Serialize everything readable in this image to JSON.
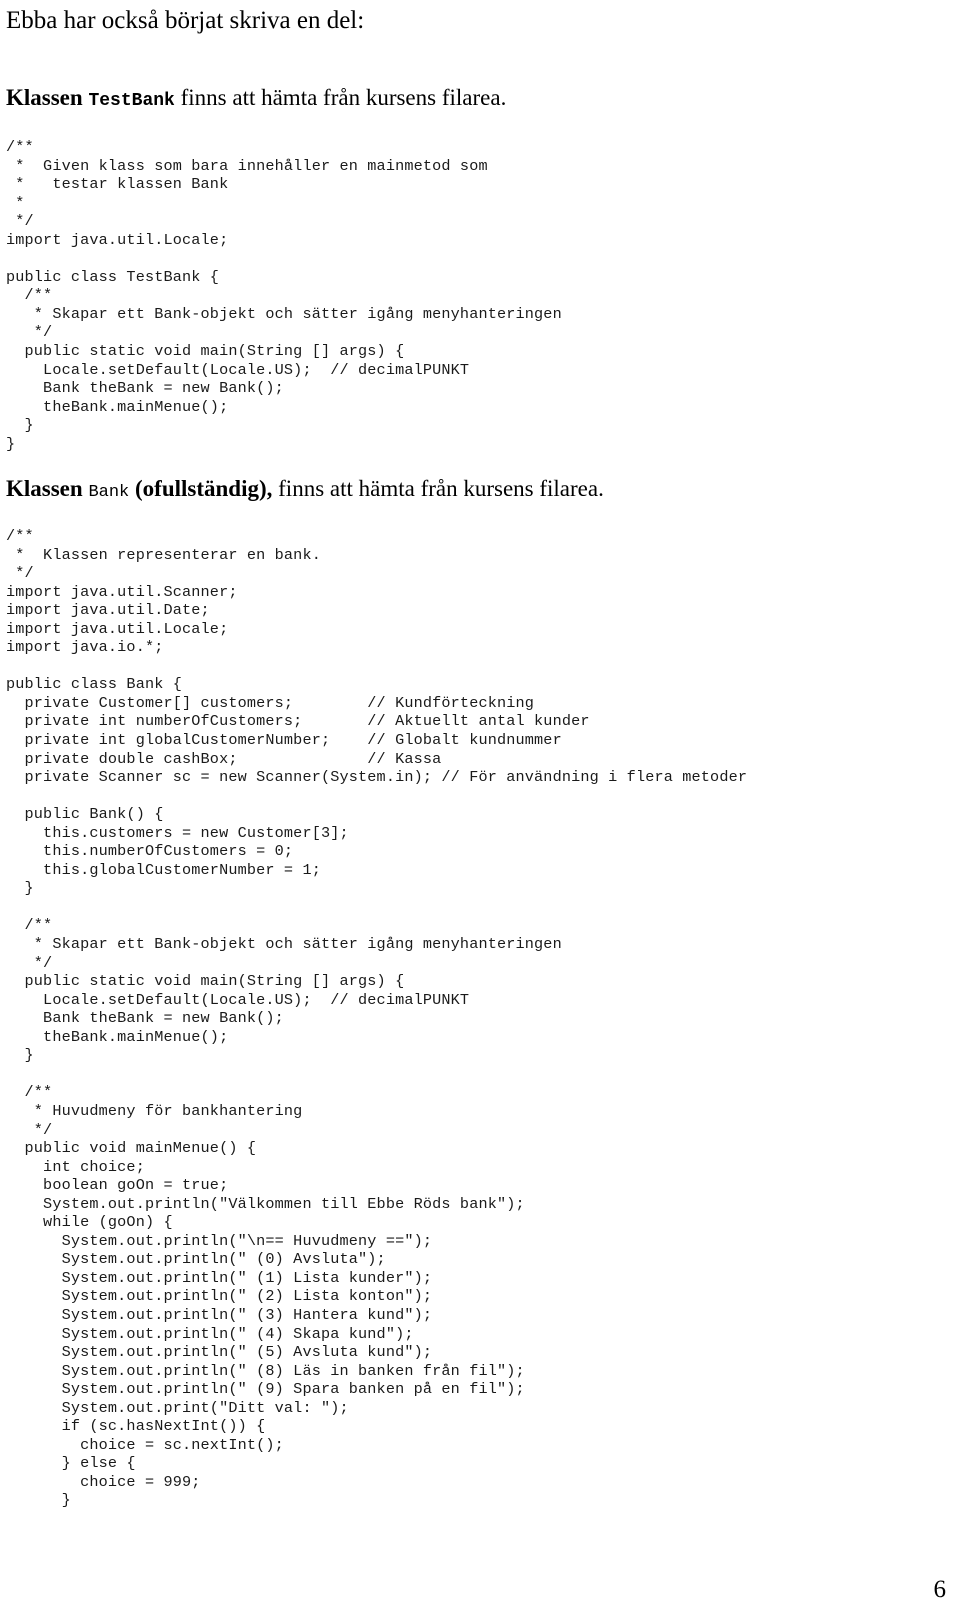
{
  "document": {
    "intro_line": "Ebba har också börjat skriva en del:",
    "page_number": "6"
  },
  "heading_testbank": {
    "prefix_bold": "Klassen",
    "class_name": "TestBank",
    "suffix": "finns att hämta från kursens filarea."
  },
  "heading_bank": {
    "prefix_bold": "Klassen",
    "class_name": "Bank",
    "qualifier_bold": "(ofullständig),",
    "suffix": "finns att hämta från kursens filarea."
  },
  "code_testbank": {
    "language": "java",
    "text": "/**\n *  Given klass som bara innehåller en mainmetod som\n *   testar klassen Bank\n *\n */\nimport java.util.Locale;\n\npublic class TestBank {\n  /**\n   * Skapar ett Bank-objekt och sätter igång menyhanteringen\n   */\n  public static void main(String [] args) {\n    Locale.setDefault(Locale.US);  // decimalPUNKT\n    Bank theBank = new Bank();\n    theBank.mainMenue();\n  }\n}"
  },
  "code_bank": {
    "language": "java",
    "text": "/**\n *  Klassen representerar en bank.\n */\nimport java.util.Scanner;\nimport java.util.Date;\nimport java.util.Locale;\nimport java.io.*;\n\npublic class Bank {\n  private Customer[] customers;        // Kundförteckning\n  private int numberOfCustomers;       // Aktuellt antal kunder\n  private int globalCustomerNumber;    // Globalt kundnummer\n  private double cashBox;              // Kassa\n  private Scanner sc = new Scanner(System.in); // För användning i flera metoder\n\n  public Bank() {\n    this.customers = new Customer[3];\n    this.numberOfCustomers = 0;\n    this.globalCustomerNumber = 1;\n  }\n\n  /**\n   * Skapar ett Bank-objekt och sätter igång menyhanteringen\n   */\n  public static void main(String [] args) {\n    Locale.setDefault(Locale.US);  // decimalPUNKT\n    Bank theBank = new Bank();\n    theBank.mainMenue();\n  }\n\n  /**\n   * Huvudmeny för bankhantering\n   */\n  public void mainMenue() {\n    int choice;\n    boolean goOn = true;\n    System.out.println(\"Välkommen till Ebbe Röds bank\");\n    while (goOn) {\n      System.out.println(\"\\n== Huvudmeny ==\");\n      System.out.println(\" (0) Avsluta\");\n      System.out.println(\" (1) Lista kunder\");\n      System.out.println(\" (2) Lista konton\");\n      System.out.println(\" (3) Hantera kund\");\n      System.out.println(\" (4) Skapa kund\");\n      System.out.println(\" (5) Avsluta kund\");\n      System.out.println(\" (8) Läs in banken från fil\");\n      System.out.println(\" (9) Spara banken på en fil\");\n      System.out.print(\"Ditt val: \");\n      if (sc.hasNextInt()) {\n        choice = sc.nextInt();\n      } else {\n        choice = 999;\n      }"
  }
}
